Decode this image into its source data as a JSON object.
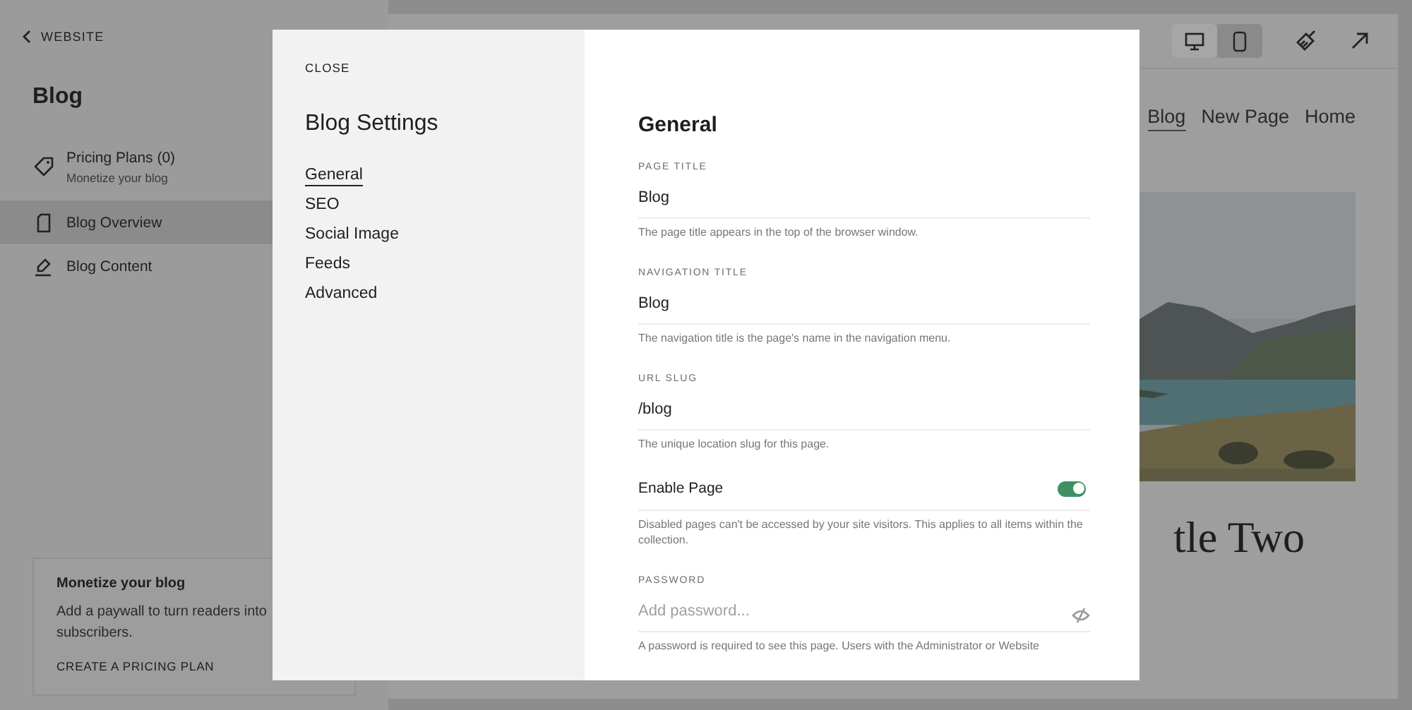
{
  "sidebar": {
    "back_link": "WEBSITE",
    "title": "Blog",
    "items": [
      {
        "kind": "tag",
        "label": "Pricing Plans (0)",
        "sublabel": "Monetize your blog",
        "selected": false
      },
      {
        "kind": "page",
        "label": "Blog Overview",
        "selected": true
      },
      {
        "kind": "edit",
        "label": "Blog Content",
        "selected": false
      }
    ],
    "promo": {
      "title": "Monetize your blog",
      "text": "Add a paywall to turn readers into subscribers.",
      "link": "CREATE A PRICING PLAN"
    }
  },
  "preview": {
    "devices": [
      {
        "kind": "desktop",
        "selected": true
      },
      {
        "kind": "mobile",
        "selected": false
      }
    ],
    "nav": [
      {
        "label": "Blog",
        "selected": true
      },
      {
        "label": "New Page",
        "selected": false
      },
      {
        "label": "Home",
        "selected": false
      }
    ],
    "heading": "tle Two"
  },
  "modal": {
    "close": "CLOSE",
    "title": "Blog Settings",
    "tabs": [
      {
        "label": "General",
        "selected": true
      },
      {
        "label": "SEO",
        "selected": false
      },
      {
        "label": "Social Image",
        "selected": false
      },
      {
        "label": "Feeds",
        "selected": false
      },
      {
        "label": "Advanced",
        "selected": false
      }
    ],
    "section_title": "General",
    "fields": [
      {
        "kind": "text",
        "label": "PAGE TITLE",
        "value": "Blog",
        "help": "The page title appears in the top of the browser window."
      },
      {
        "kind": "text",
        "label": "NAVIGATION TITLE",
        "value": "Blog",
        "help": "The navigation title is the page's name in the navigation menu."
      },
      {
        "kind": "text",
        "label": "URL SLUG",
        "value": "/blog",
        "help": "The unique location slug for this page."
      },
      {
        "kind": "toggle",
        "label": "Enable Page",
        "on": true,
        "help": "Disabled pages can't be accessed by your site visitors. This applies to all items within the collection."
      },
      {
        "kind": "password",
        "label": "PASSWORD",
        "placeholder": "Add password...",
        "help": "A password is required to see this page. Users with the Administrator or Website"
      }
    ]
  }
}
